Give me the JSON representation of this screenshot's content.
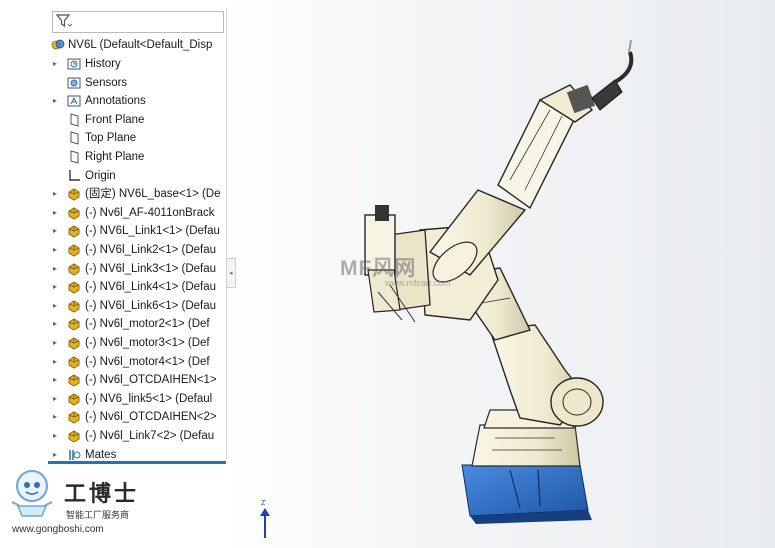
{
  "tree": {
    "filter_placeholder": "",
    "root_label": "NV6L  (Default<Default_Disp",
    "items": [
      {
        "label": "History",
        "icon": "history-icon",
        "has_arrow": true
      },
      {
        "label": "Sensors",
        "icon": "sensors-icon",
        "has_arrow": false
      },
      {
        "label": "Annotations",
        "icon": "annotations-icon",
        "has_arrow": true
      },
      {
        "label": "Front Plane",
        "icon": "plane-icon",
        "has_arrow": false
      },
      {
        "label": "Top Plane",
        "icon": "plane-icon",
        "has_arrow": false
      },
      {
        "label": "Right Plane",
        "icon": "plane-icon",
        "has_arrow": false
      },
      {
        "label": "Origin",
        "icon": "origin-icon",
        "has_arrow": false
      },
      {
        "label": "(固定) NV6L_base<1> (De",
        "icon": "part-icon",
        "has_arrow": true
      },
      {
        "label": "(-) Nv6l_AF-4011onBrack",
        "icon": "part-icon",
        "has_arrow": true
      },
      {
        "label": "(-) NV6L_Link1<1> (Defau",
        "icon": "part-icon",
        "has_arrow": true
      },
      {
        "label": "(-) NV6l_Link2<1> (Defau",
        "icon": "part-icon",
        "has_arrow": true
      },
      {
        "label": "(-) NV6l_Link3<1> (Defau",
        "icon": "part-icon",
        "has_arrow": true
      },
      {
        "label": "(-) NV6l_Link4<1> (Defau",
        "icon": "part-icon",
        "has_arrow": true
      },
      {
        "label": "(-) NV6l_Link6<1> (Defau",
        "icon": "part-icon",
        "has_arrow": true
      },
      {
        "label": "(-) Nv6l_motor2<1> (Def",
        "icon": "part-icon",
        "has_arrow": true
      },
      {
        "label": "(-) Nv6l_motor3<1> (Def",
        "icon": "part-icon",
        "has_arrow": true
      },
      {
        "label": "(-) Nv6l_motor4<1> (Def",
        "icon": "part-icon",
        "has_arrow": true
      },
      {
        "label": "(-) Nv6l_OTCDAIHEN<1>",
        "icon": "part-icon",
        "has_arrow": true
      },
      {
        "label": "(-) NV6_link5<1> (Defaul",
        "icon": "part-icon",
        "has_arrow": true
      },
      {
        "label": "(-) Nv6l_OTCDAIHEN<2>",
        "icon": "part-icon",
        "has_arrow": true
      },
      {
        "label": "(-) Nv6l_Link7<2> (Defau",
        "icon": "part-icon",
        "has_arrow": true
      },
      {
        "label": "Mates",
        "icon": "mates-icon",
        "has_arrow": true
      }
    ]
  },
  "watermark": {
    "logo_title": "工博士",
    "logo_sub": "智能工厂服务商",
    "logo_url": "www.gongboshi.com",
    "center_text": "MF风网",
    "center_url": "www.mfcad.com"
  },
  "triad": {
    "axis_label": "Z"
  },
  "colors": {
    "accent": "#1f72c4",
    "robot_body": "#f3efdc",
    "robot_base": "#2d6fc2",
    "part_icon": "#e5b21f"
  }
}
